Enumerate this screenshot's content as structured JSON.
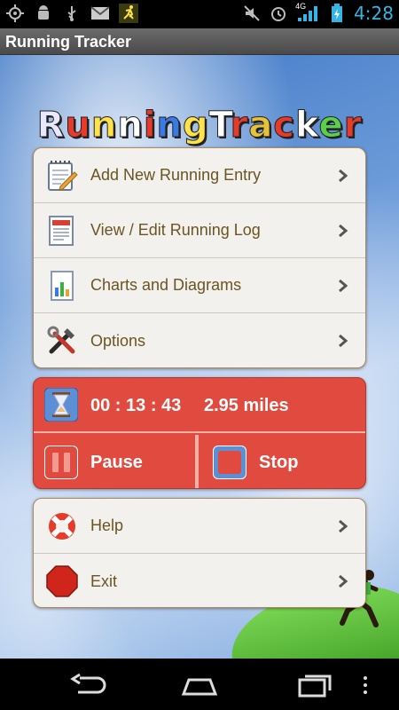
{
  "status_bar": {
    "time": "4:28",
    "network_label": "4G",
    "icons": [
      "gps-icon",
      "android-debug-icon",
      "usb-icon",
      "gmail-icon",
      "running-app-icon",
      "mute-icon",
      "alarm-icon",
      "signal-icon",
      "battery-charging-icon"
    ]
  },
  "action_bar": {
    "title": "Running Tracker"
  },
  "logo": {
    "letters": [
      "R",
      "u",
      "n",
      "n",
      "i",
      "n",
      "g",
      "T",
      "r",
      "a",
      "c",
      "k",
      "e",
      "r"
    ]
  },
  "menu": {
    "items": [
      {
        "label": "Add New Running Entry",
        "icon": "notepad-pencil-icon"
      },
      {
        "label": "View / Edit Running Log",
        "icon": "log-document-icon"
      },
      {
        "label": "Charts and Diagrams",
        "icon": "chart-document-icon"
      },
      {
        "label": "Options",
        "icon": "tools-icon"
      }
    ]
  },
  "timer": {
    "elapsed": "00 : 13 : 43",
    "distance": "2.95 miles",
    "pause_label": "Pause",
    "stop_label": "Stop"
  },
  "secondary_menu": {
    "items": [
      {
        "label": "Help",
        "icon": "lifebuoy-icon"
      },
      {
        "label": "Exit",
        "icon": "stop-sign-icon"
      }
    ]
  },
  "colors": {
    "accent_red": "#e14a3e",
    "menu_text": "#6b5520",
    "status_blue": "#33b5e5"
  }
}
